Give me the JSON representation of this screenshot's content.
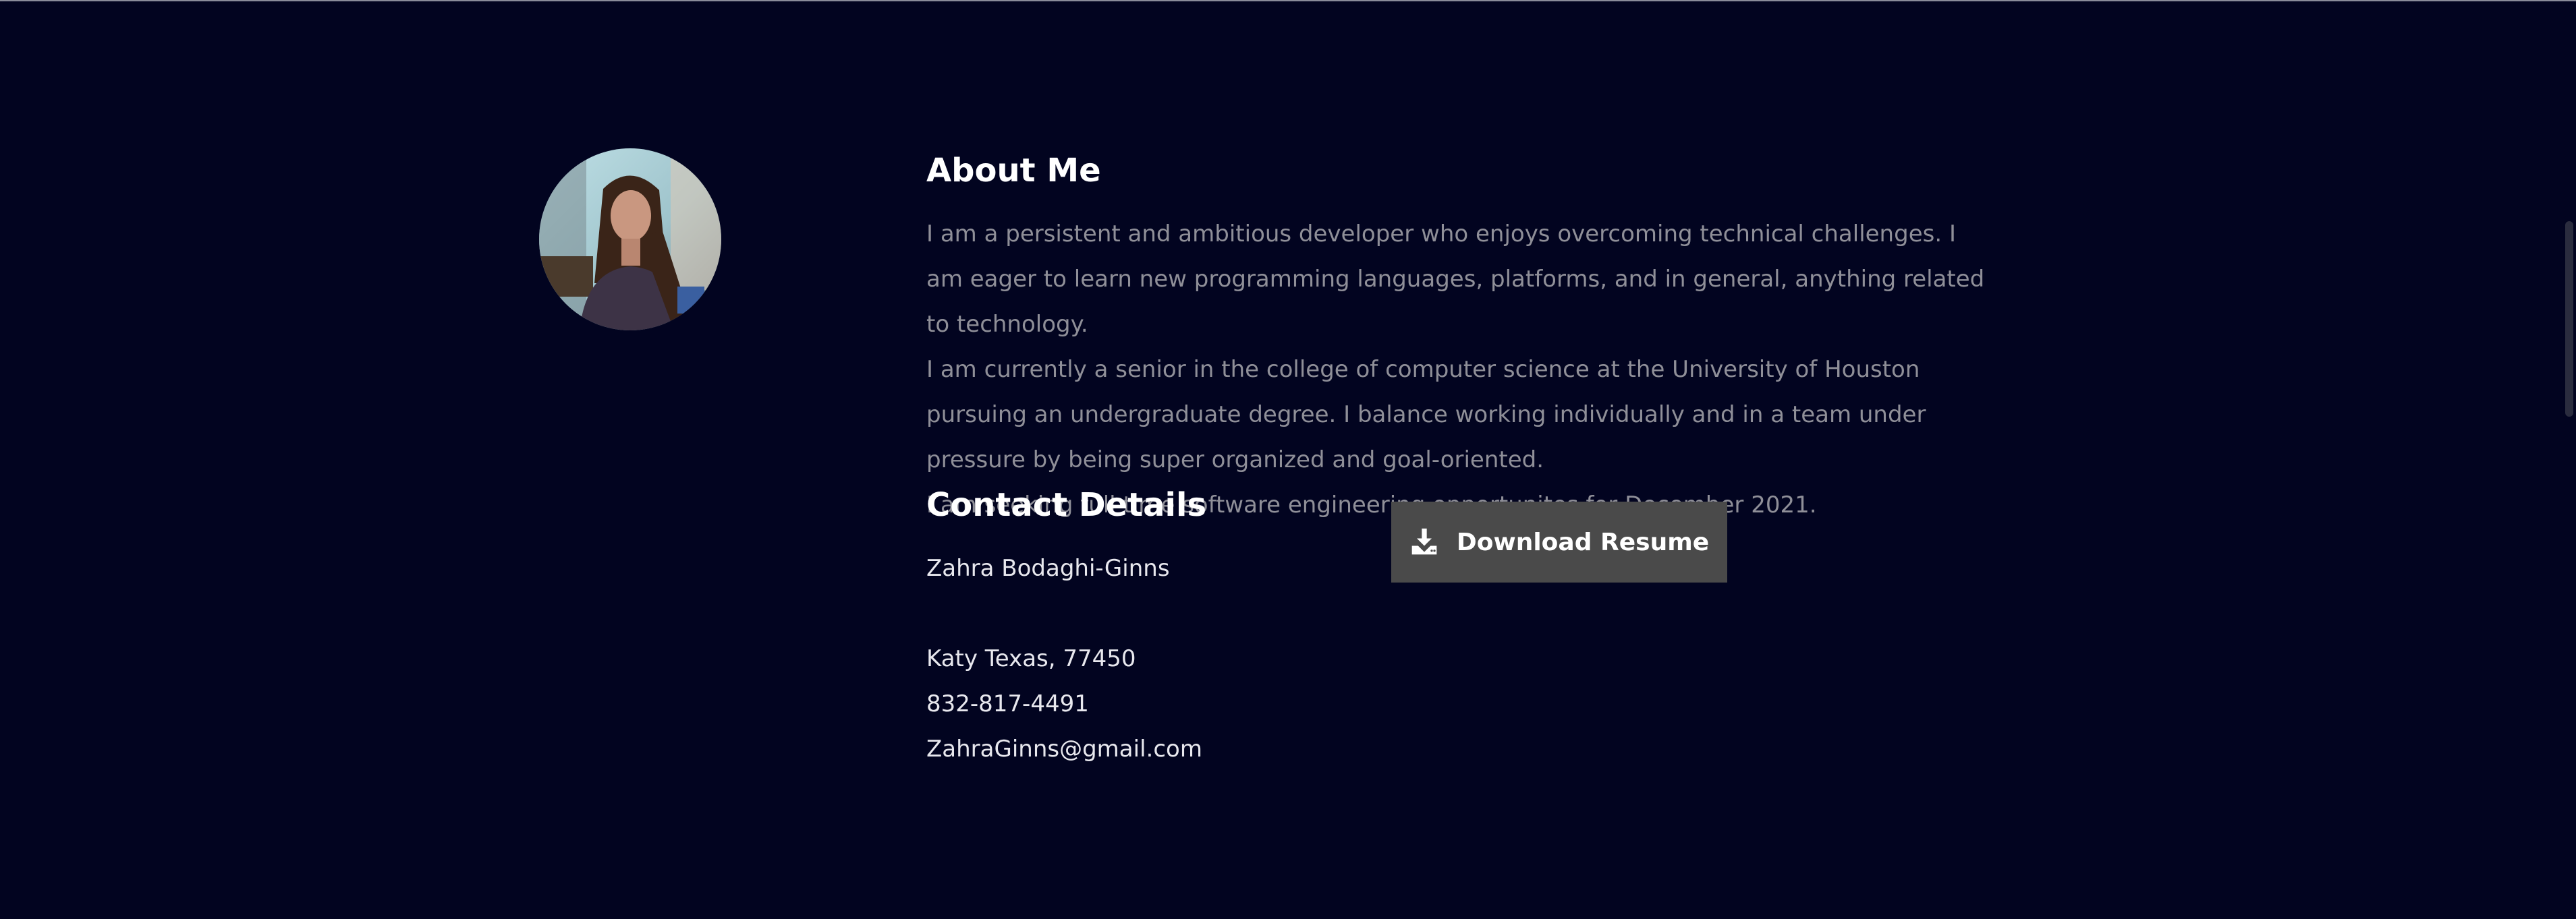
{
  "about": {
    "avatar_alt": "profile photo",
    "title": "About Me",
    "paragraphs": [
      "I am a persistent and ambitious developer who enjoys overcoming technical challenges. I am eager to learn new programming languages, platforms, and in general, anything related to technology.",
      "I am currently a senior in the college of computer science at the University of Houston pursuing an undergraduate degree. I balance working individually and in a team under pressure by being super organized and goal-oriented.",
      "I am seeking full time software engineering opportunites for December 2021."
    ]
  },
  "contact": {
    "title": "Contact Details",
    "name": "Zahra Bodaghi-Ginns",
    "location": "Katy Texas, 77450",
    "phone": "832-817-4491",
    "email": "ZahraGinns@gmail.com"
  },
  "resume_button": {
    "label": "Download Resume",
    "icon": "download-icon"
  },
  "colors": {
    "background": "#020420",
    "heading": "#ffffff",
    "body_text": "#8f8f98",
    "button_bg": "#4a4a4a"
  }
}
